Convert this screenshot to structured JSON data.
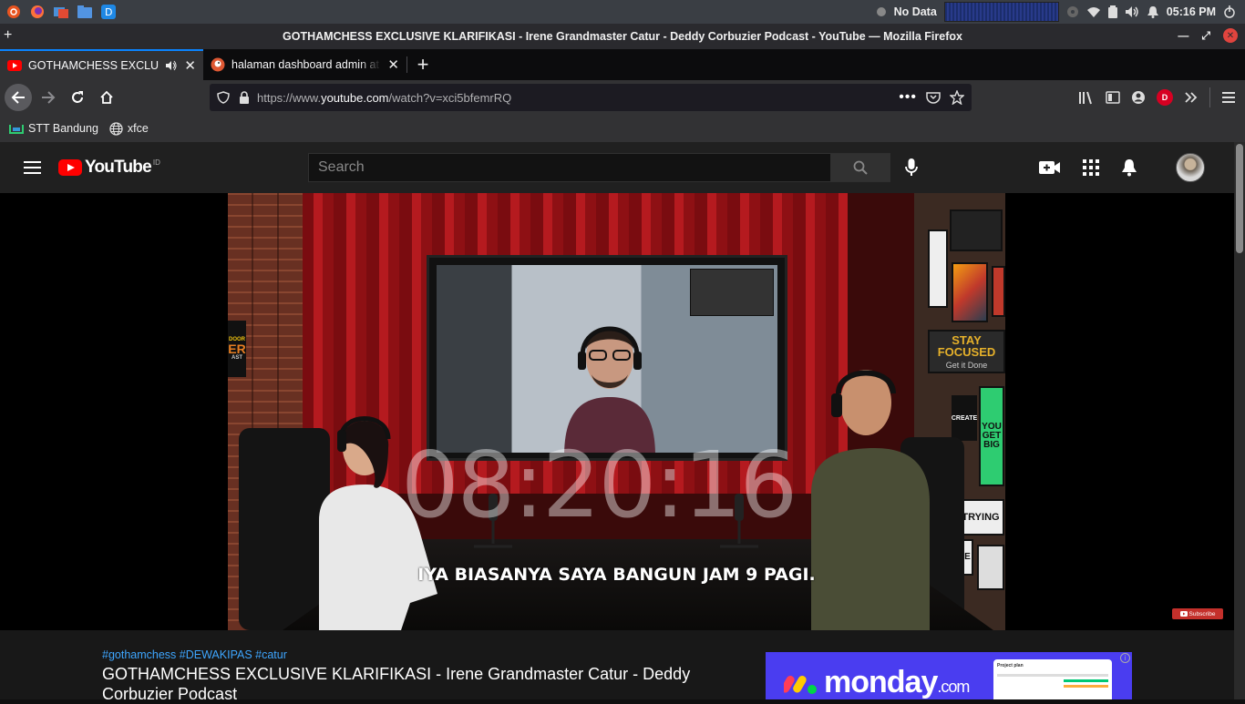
{
  "panel": {
    "network_status": "No Data",
    "clock": "05:16 PM"
  },
  "window": {
    "title": "GOTHAMCHESS EXCLUSIVE KLARIFIKASI - Irene Grandmaster Catur - Deddy Corbuzier Podcast - YouTube — Mozilla Firefox"
  },
  "tabs": [
    {
      "title": "GOTHAMCHESS EXCLUSIVE KLARIFIKASI - Irene Grandmaster Catur - Deddy Corbuzier Podcast - YouTube",
      "active": true
    },
    {
      "title": "halaman dashboard admin at DuckDuckGo",
      "active": false
    }
  ],
  "urlbar": {
    "prefix": "https://www.",
    "host": "youtube.com",
    "path": "/watch?v=xci5bfemrRQ"
  },
  "bookmarks": [
    {
      "label": "STT Bandung"
    },
    {
      "label": "xfce"
    }
  ],
  "account_badge": "D",
  "youtube": {
    "logo_text": "YouTube",
    "country": "ID",
    "search_placeholder": "Search"
  },
  "video": {
    "overlay_timer": "08:20:16",
    "caption": "IYA BIASANYA SAYA BANGUN JAM 9 PAGI.",
    "watermark": "Subscribe",
    "posters": {
      "stay_focused": "STAY FOCUSED",
      "get_it_done": "Get it Done",
      "you_big": "YOU GET BIG",
      "trying": "TRYING",
      "create": "CREATE",
      "life": "LIFE",
      "podcast_sign_1": "DOOR",
      "podcast_sign_2": "ER",
      "podcast_sign_3": "AST"
    }
  },
  "below": {
    "hashtags": "#gothamchess #DEWAKIPAS #catur",
    "title": "GOTHAMCHESS EXCLUSIVE KLARIFIKASI - Irene Grandmaster Catur - Deddy Corbuzier Podcast"
  },
  "ad": {
    "brand": "monday",
    "brand_suffix": ".com",
    "card_title": "Project plan",
    "info": "i"
  },
  "colors": {
    "yt_red": "#ff0000",
    "link_blue": "#3ea6ff",
    "firefox_accent": "#0a84ff",
    "monday_purple": "#4a3df0"
  }
}
